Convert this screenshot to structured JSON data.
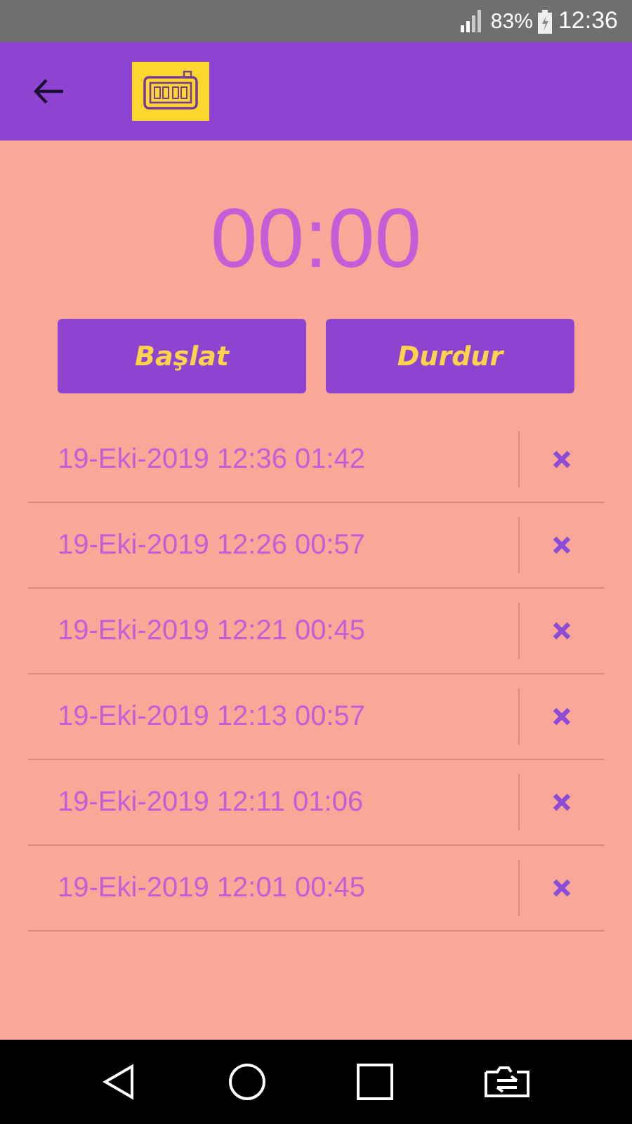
{
  "status_bar": {
    "battery": "83%",
    "time": "12:36"
  },
  "timer": "00:00",
  "buttons": [
    {
      "label": "Başlat"
    },
    {
      "label": "Durdur"
    }
  ],
  "records": [
    {
      "text": "19-Eki-2019 12:36 01:42"
    },
    {
      "text": "19-Eki-2019 12:26 00:57"
    },
    {
      "text": "19-Eki-2019 12:21 00:45"
    },
    {
      "text": "19-Eki-2019 12:13 00:57"
    },
    {
      "text": "19-Eki-2019 12:11 01:06"
    },
    {
      "text": "19-Eki-2019 12:01 00:45"
    }
  ]
}
